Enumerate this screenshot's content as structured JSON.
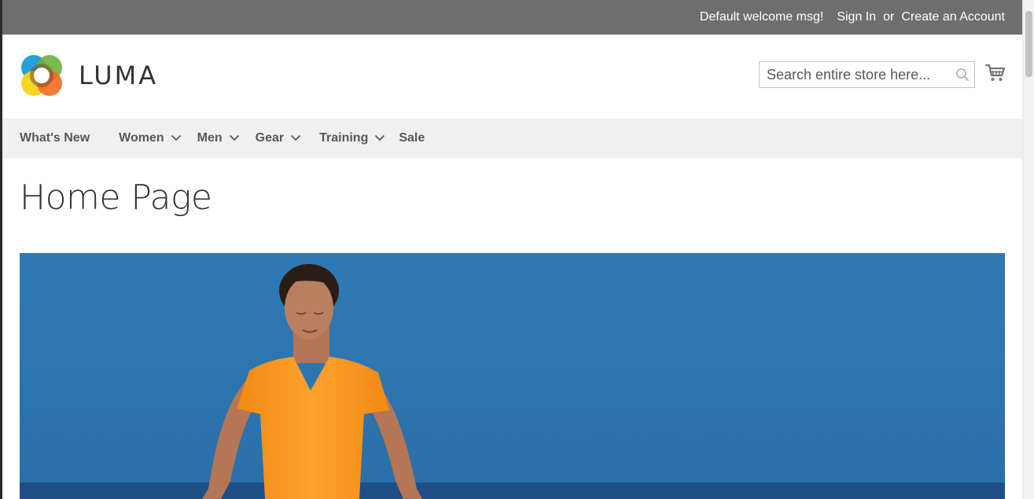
{
  "topbar": {
    "welcome": "Default welcome msg!",
    "sign_in": "Sign In",
    "or": "or",
    "create_account": "Create an Account"
  },
  "header": {
    "logo_text": "LUMA",
    "search_placeholder": "Search entire store here...",
    "icons": {
      "search": "search-icon",
      "cart": "cart-icon"
    }
  },
  "nav": {
    "items": [
      {
        "label": "What's New",
        "dropdown": false
      },
      {
        "label": "Women",
        "dropdown": true
      },
      {
        "label": "Men",
        "dropdown": true
      },
      {
        "label": "Gear",
        "dropdown": true
      },
      {
        "label": "Training",
        "dropdown": true
      },
      {
        "label": "Sale",
        "dropdown": false
      }
    ]
  },
  "main": {
    "page_title": "Home Page"
  },
  "colors": {
    "topbar_bg": "#6e6e6e",
    "nav_bg": "#f0f0f0",
    "hero_sky": "#2f7fb8",
    "shirt": "#f7931e"
  }
}
